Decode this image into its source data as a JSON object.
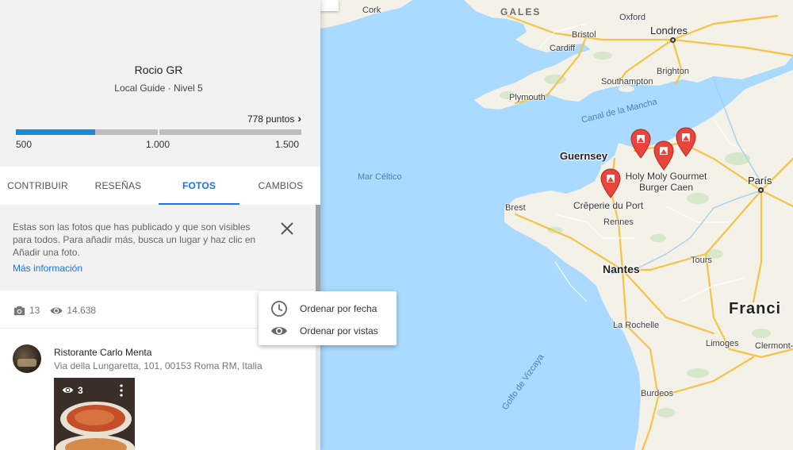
{
  "profile": {
    "name": "Rocio GR",
    "subtitle": "Local Guide · Nivel 5",
    "points_label": "778 puntos",
    "progress_value": 778,
    "progress_min": 500,
    "progress_max": 1500,
    "scale": [
      "500",
      "1.000",
      "1.500"
    ]
  },
  "tabs": [
    {
      "label": "CONTRIBUIR"
    },
    {
      "label": "RESEÑAS"
    },
    {
      "label": "FOTOS",
      "active": true
    },
    {
      "label": "CAMBIOS"
    }
  ],
  "info": {
    "text": "Estas son las fotos que has publicado y que son visibles para todos. Para añadir más, busca un lugar y haz clic en Añadir una foto.",
    "link": "Más información"
  },
  "stats": {
    "photos": "13",
    "views": "14.638"
  },
  "sort_menu": {
    "by_date": "Ordenar por fecha",
    "by_views": "Ordenar por vistas"
  },
  "place": {
    "title": "Ristorante Carlo Menta",
    "address": "Via della Lungaretta, 101, 00153 Roma RM, Italia",
    "photo_views": "3"
  },
  "map": {
    "regions": {
      "gales": "GALES"
    },
    "cities": {
      "cork": "Cork",
      "oxford": "Oxford",
      "londres": "Londres",
      "bristol": "Bristol",
      "cardiff": "Cardiff",
      "brighton": "Brighton",
      "southampton": "Southampton",
      "plymouth": "Plymouth",
      "guernsey": "Guernsey",
      "paris": "París",
      "brest": "Brest",
      "rennes": "Rennes",
      "nantes": "Nantes",
      "tours": "Tours",
      "la_rochelle": "La Rochelle",
      "limoges": "Limoges",
      "clermont": "Clermont-",
      "burdeos": "Burdeos",
      "francia": "Franci"
    },
    "seas": {
      "canal": "Canal de la Mancha",
      "celtico": "Mar Céltico",
      "vizcaya": "Golfo de Vizcaya"
    },
    "pois": {
      "holy_moly": "Holy Moly Gourmet Burger Caen",
      "creperie": "Crêperie du Port"
    },
    "colors": {
      "sea": "#aadaff",
      "land": "#f5f1e8",
      "road": "#f7c44a",
      "pin": "#e8453c"
    }
  }
}
